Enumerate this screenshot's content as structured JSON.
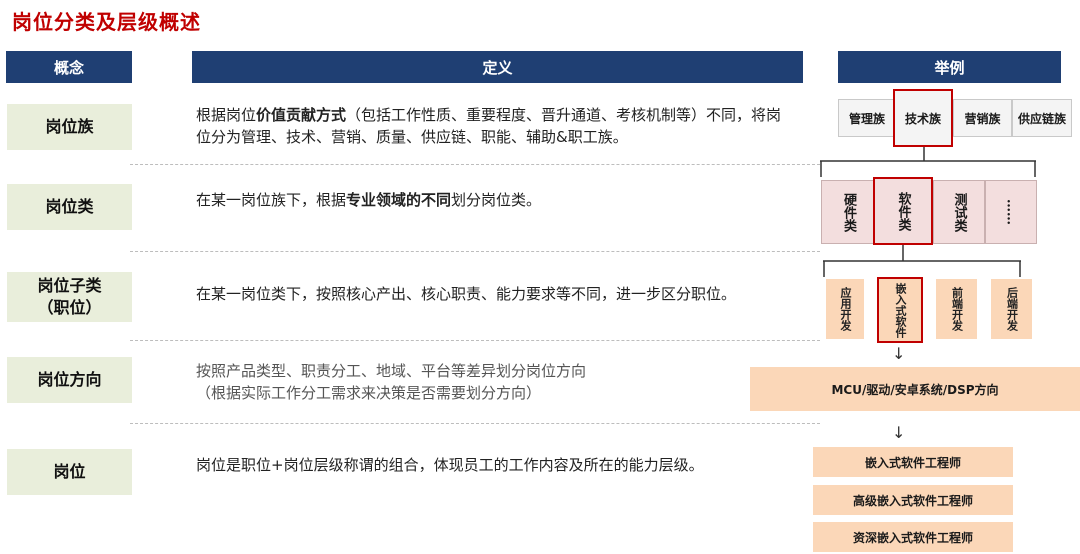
{
  "title": "岗位分类及层级概述",
  "headers": {
    "concept": "概念",
    "definition": "定义",
    "example": "举例"
  },
  "rows": {
    "family": {
      "concept": "岗位族",
      "def_pre": "根据岗位",
      "def_bold": "价值贡献方式",
      "def_post": "（包括工作性质、重要程度、晋升通道、考核机制等）不同，将岗位分为管理、技术、营销、质量、供应链、职能、辅助&职工族。"
    },
    "category": {
      "concept": "岗位类",
      "def_pre": "在某一岗位族下，根据",
      "def_bold": "专业领域的不同",
      "def_post": "划分岗位类。"
    },
    "subcategory": {
      "concept_line1": "岗位子类",
      "concept_line2": "（职位）",
      "def": "在某一岗位类下，按照核心产出、核心职责、能力要求等不同，进一步区分职位。"
    },
    "direction": {
      "concept": "岗位方向",
      "def_line1": "按照产品类型、职责分工、地域、平台等差异划分岗位方向",
      "def_line2": "（根据实际工作分工需求来决策是否需要划分方向）"
    },
    "position": {
      "concept": "岗位",
      "def": "岗位是职位+岗位层级称谓的组合，体现员工的工作内容及所在的能力层级。"
    }
  },
  "example": {
    "families": [
      "管理族",
      "技术族",
      "营销族",
      "供应链族"
    ],
    "categories": [
      "硬件类",
      "软件类",
      "测试类",
      "……"
    ],
    "subcategories": [
      "应用开发",
      "嵌入式软件",
      "前端开发",
      "后端开发"
    ],
    "direction": "MCU/驱动/安卓系统/DSP方向",
    "positions": [
      "嵌入式软件工程师",
      "高级嵌入式软件工程师",
      "资深嵌入式软件工程师"
    ],
    "arrow": "↓",
    "highlight_color": "#c00000"
  }
}
